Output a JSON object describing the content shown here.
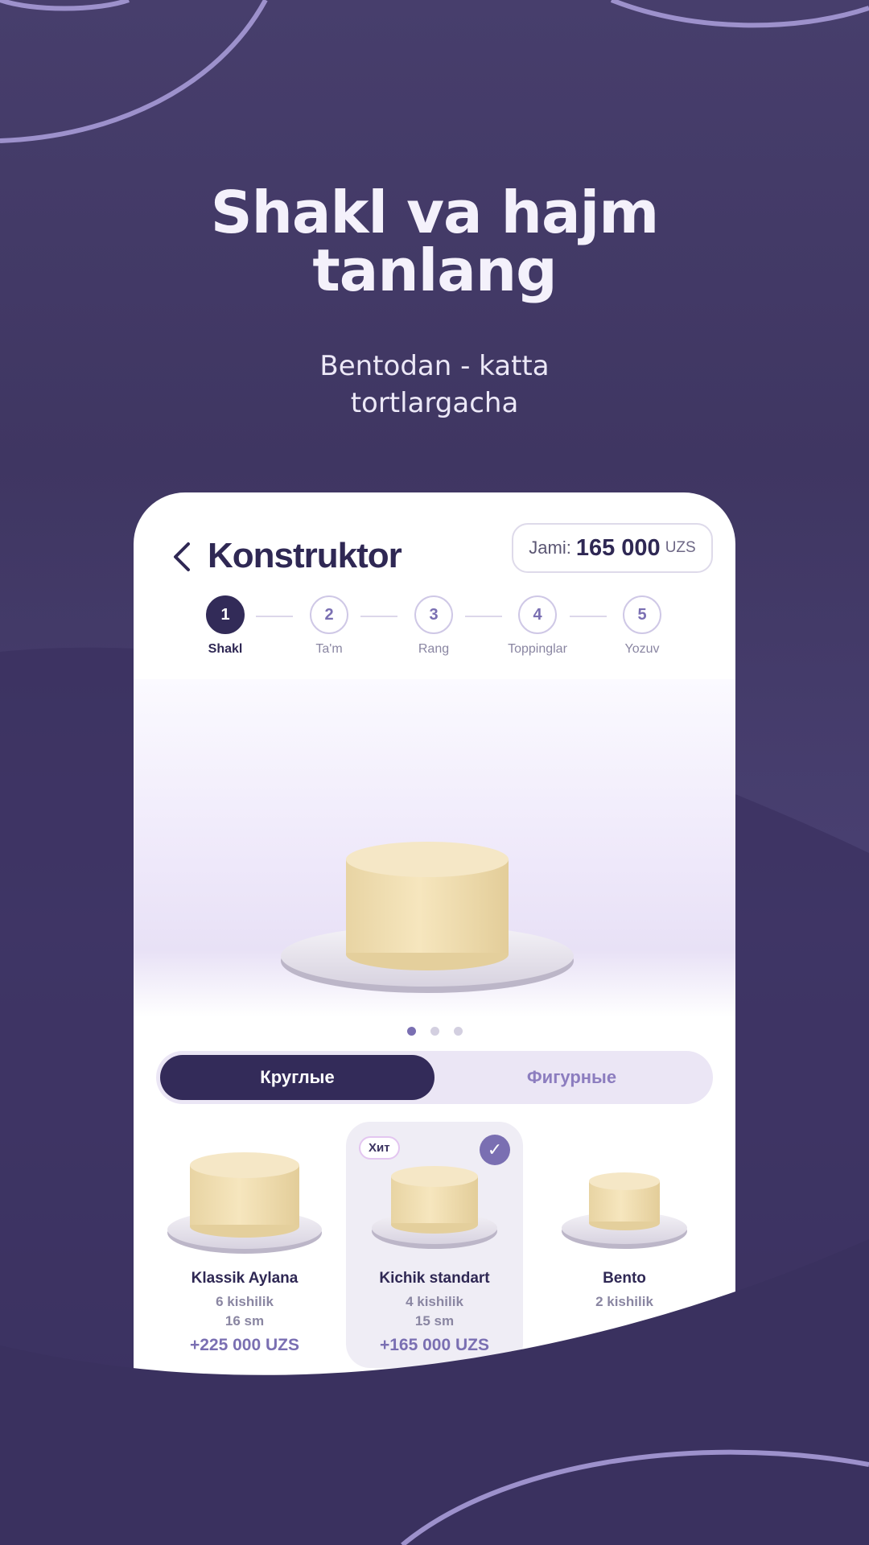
{
  "hero": {
    "title_line1": "Shakl va hajm",
    "title_line2": "tanlang",
    "subtitle_line1": "Bentodan - katta",
    "subtitle_line2": "tortlargacha"
  },
  "header": {
    "title": "Konstruktor",
    "total_label": "Jami:",
    "total_amount": "165 000",
    "total_currency": "UZS"
  },
  "steps": [
    {
      "number": "1",
      "label": "Shakl",
      "active": true
    },
    {
      "number": "2",
      "label": "Ta'm"
    },
    {
      "number": "3",
      "label": "Rang"
    },
    {
      "number": "4",
      "label": "Toppinglar"
    },
    {
      "number": "5",
      "label": "Yozuv"
    }
  ],
  "carousel": {
    "pages": 3,
    "current": 1
  },
  "tabs": [
    {
      "label": "Круглые",
      "active": true
    },
    {
      "label": "Фигурные"
    }
  ],
  "cards": [
    {
      "name": "Klassik Aylana",
      "people": "6 kishilik",
      "size": "16 sm",
      "price": "+225 000 UZS"
    },
    {
      "name": "Kichik standart",
      "people": "4 kishilik",
      "size": "15 sm",
      "price": "+165 000 UZS",
      "badge": "Хит",
      "selected": true
    },
    {
      "name": "Bento",
      "people": "2 kishilik",
      "size": "",
      "price": ""
    }
  ],
  "colors": {
    "background": "#463c6a",
    "primary_dark": "#322b58",
    "accent": "#7a6fb2"
  },
  "icons": {
    "back": "chevron-left-icon",
    "check": "check-icon"
  }
}
